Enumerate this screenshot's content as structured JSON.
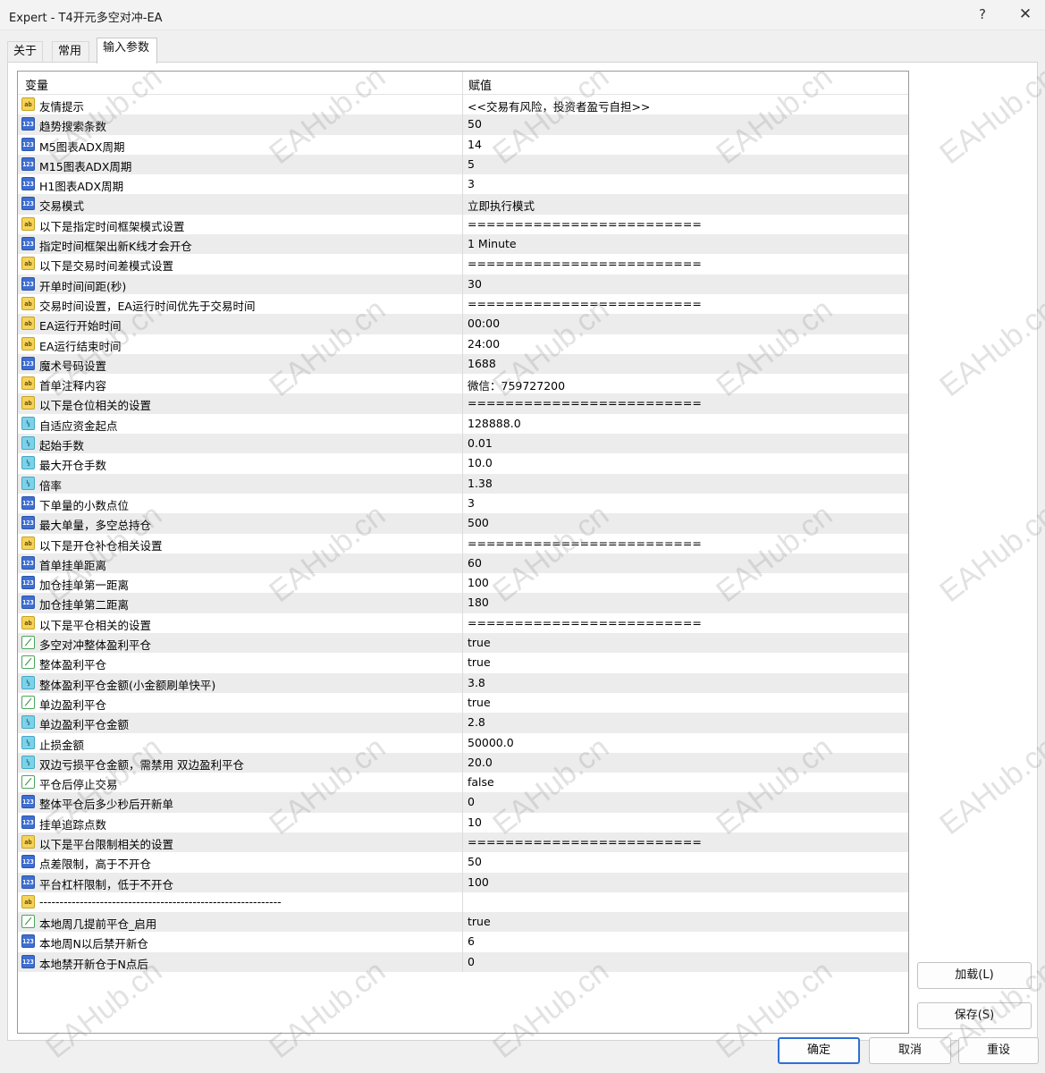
{
  "window": {
    "title": "Expert - T4开元多空对冲-EA",
    "help_label": "?",
    "close_label": "✕"
  },
  "tabs": [
    {
      "label": "关于"
    },
    {
      "label": "常用"
    },
    {
      "label": "输入参数"
    }
  ],
  "active_tab": "输入参数",
  "grid": {
    "col_variable": "变量",
    "col_value": "赋值"
  },
  "params": [
    {
      "type": "string",
      "name": "友情提示",
      "value": "<<交易有风险，投资者盈亏自担>>"
    },
    {
      "type": "int",
      "name": "趋势搜索条数",
      "value": "50"
    },
    {
      "type": "int",
      "name": "M5图表ADX周期",
      "value": "14"
    },
    {
      "type": "int",
      "name": "M15图表ADX周期",
      "value": "5"
    },
    {
      "type": "int",
      "name": "H1图表ADX周期",
      "value": "3"
    },
    {
      "type": "int",
      "name": "交易模式",
      "value": "立即执行模式"
    },
    {
      "type": "string",
      "name": "以下是指定时间框架模式设置",
      "value": "========================="
    },
    {
      "type": "int",
      "name": "指定时间框架出新K线才会开仓",
      "value": "1 Minute"
    },
    {
      "type": "string",
      "name": "以下是交易时间差模式设置",
      "value": "========================="
    },
    {
      "type": "int",
      "name": "开单时间间距(秒)",
      "value": "30"
    },
    {
      "type": "string",
      "name": "交易时间设置，EA运行时间优先于交易时间",
      "value": "========================="
    },
    {
      "type": "string",
      "name": "EA运行开始时间",
      "value": "00:00"
    },
    {
      "type": "string",
      "name": "EA运行结束时间",
      "value": "24:00"
    },
    {
      "type": "int",
      "name": "魔术号码设置",
      "value": "1688"
    },
    {
      "type": "string",
      "name": "首单注释内容",
      "value": "微信：759727200"
    },
    {
      "type": "string",
      "name": "以下是仓位相关的设置",
      "value": "========================="
    },
    {
      "type": "double",
      "name": "自适应资金起点",
      "value": "128888.0"
    },
    {
      "type": "double",
      "name": "起始手数",
      "value": "0.01"
    },
    {
      "type": "double",
      "name": "最大开仓手数",
      "value": "10.0"
    },
    {
      "type": "double",
      "name": "倍率",
      "value": "1.38"
    },
    {
      "type": "int",
      "name": "下单量的小数点位",
      "value": "3"
    },
    {
      "type": "int",
      "name": "最大单量，多空总持仓",
      "value": "500"
    },
    {
      "type": "string",
      "name": "以下是开仓补仓相关设置",
      "value": "========================="
    },
    {
      "type": "int",
      "name": "首单挂单距离",
      "value": "60"
    },
    {
      "type": "int",
      "name": "加仓挂单第一距离",
      "value": "100"
    },
    {
      "type": "int",
      "name": "加仓挂单第二距离",
      "value": "180"
    },
    {
      "type": "string",
      "name": "以下是平仓相关的设置",
      "value": "========================="
    },
    {
      "type": "bool",
      "name": "多空对冲整体盈利平仓",
      "value": "true"
    },
    {
      "type": "bool",
      "name": "整体盈利平仓",
      "value": "true"
    },
    {
      "type": "double",
      "name": "整体盈利平仓金额(小金额刷单快平)",
      "value": "3.8"
    },
    {
      "type": "bool",
      "name": "单边盈利平仓",
      "value": "true"
    },
    {
      "type": "double",
      "name": "单边盈利平仓金额",
      "value": "2.8"
    },
    {
      "type": "double",
      "name": "止损金额",
      "value": "50000.0"
    },
    {
      "type": "double",
      "name": "双边亏损平仓金额，需禁用 双边盈利平仓",
      "value": "20.0"
    },
    {
      "type": "bool",
      "name": "平仓后停止交易",
      "value": "false"
    },
    {
      "type": "int",
      "name": "整体平仓后多少秒后开新单",
      "value": "0"
    },
    {
      "type": "int",
      "name": "挂单追踪点数",
      "value": "10"
    },
    {
      "type": "string",
      "name": "以下是平台限制相关的设置",
      "value": "========================="
    },
    {
      "type": "int",
      "name": "点差限制，高于不开仓",
      "value": "50"
    },
    {
      "type": "int",
      "name": "平台杠杆限制，低于不开仓",
      "value": "100"
    },
    {
      "type": "string",
      "name": "------------------------------------------------------------",
      "value": ""
    },
    {
      "type": "bool",
      "name": "本地周几提前平仓_启用",
      "value": "true"
    },
    {
      "type": "int",
      "name": "本地周N以后禁开新仓",
      "value": "6"
    },
    {
      "type": "int",
      "name": "本地禁开新仓于N点后",
      "value": "0"
    }
  ],
  "type_icons": {
    "string": "ab",
    "int": "123",
    "double": "½",
    "bool": "⟋"
  },
  "buttons": {
    "load": "加载(L)",
    "save": "保存(S)",
    "ok": "确定",
    "cancel": "取消",
    "reset": "重设"
  },
  "watermark": "EAHub.cn",
  "colors": {
    "primary_border": "#2f6fd6",
    "row_alt": "#ececec"
  }
}
